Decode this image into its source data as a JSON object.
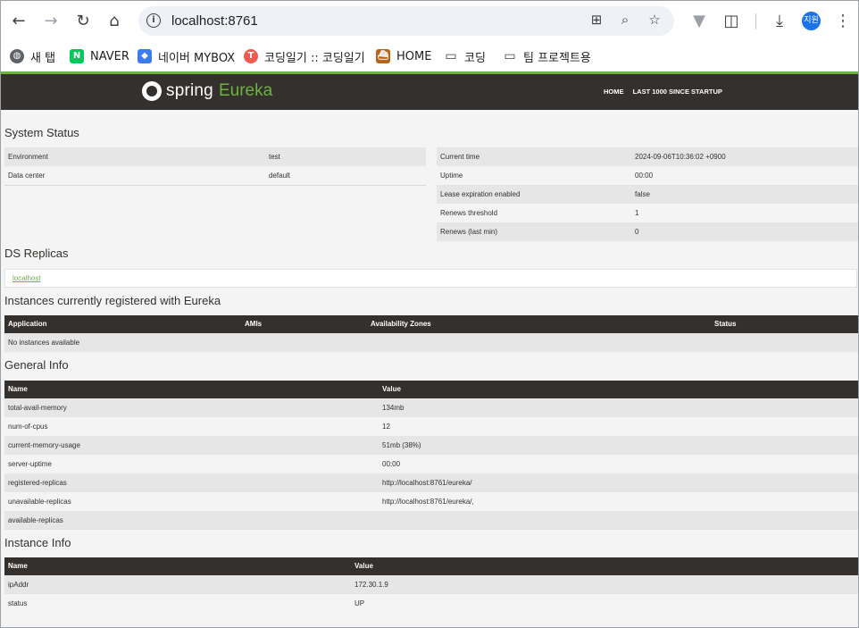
{
  "browser": {
    "url": "localhost:8761",
    "profile_label": "지원",
    "bookmarks": [
      "새 탭",
      "NAVER",
      "네이버 MYBOX",
      "코딩일기 :: 코딩일기",
      "HOME",
      "코딩",
      "팀 프로젝트용"
    ]
  },
  "navbar": {
    "brand_spring": "spring",
    "brand_eureka": "Eureka",
    "links": [
      "HOME",
      "LAST 1000 SINCE STARTUP"
    ]
  },
  "system_status": {
    "title": "System Status",
    "left": [
      {
        "label": "Environment",
        "value": "test"
      },
      {
        "label": "Data center",
        "value": "default"
      }
    ],
    "right": [
      {
        "label": "Current time",
        "value": "2024-09-06T10:36:02 +0900"
      },
      {
        "label": "Uptime",
        "value": "00:00"
      },
      {
        "label": "Lease expiration enabled",
        "value": "false"
      },
      {
        "label": "Renews threshold",
        "value": "1"
      },
      {
        "label": "Renews (last min)",
        "value": "0"
      }
    ]
  },
  "ds_replicas": {
    "title": "DS Replicas",
    "items": [
      "localhost"
    ]
  },
  "instances": {
    "title": "Instances currently registered with Eureka",
    "columns": [
      "Application",
      "AMIs",
      "Availability Zones",
      "Status"
    ],
    "empty_text": "No instances available"
  },
  "general_info": {
    "title": "General Info",
    "columns": [
      "Name",
      "Value"
    ],
    "rows": [
      {
        "name": "total-avail-memory",
        "value": "134mb"
      },
      {
        "name": "num-of-cpus",
        "value": "12"
      },
      {
        "name": "current-memory-usage",
        "value": "51mb (38%)"
      },
      {
        "name": "server-uptime",
        "value": "00:00"
      },
      {
        "name": "registered-replicas",
        "value": "http://localhost:8761/eureka/"
      },
      {
        "name": "unavailable-replicas",
        "value": "http://localhost:8761/eureka/,"
      },
      {
        "name": "available-replicas",
        "value": ""
      }
    ]
  },
  "instance_info": {
    "title": "Instance Info",
    "columns": [
      "Name",
      "Value"
    ],
    "rows": [
      {
        "name": "ipAddr",
        "value": "172.30.1.9"
      },
      {
        "name": "status",
        "value": "UP"
      }
    ]
  }
}
